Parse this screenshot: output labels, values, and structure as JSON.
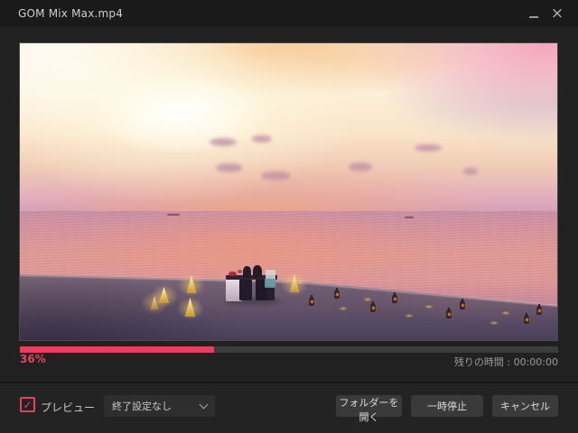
{
  "window": {
    "title": "GOM Mix Max.mp4",
    "close_glyph": "×"
  },
  "colors": {
    "accent_pink": "#ee3d5c",
    "checkbox_red": "#e04560",
    "button_bg": "#3a3a3a",
    "titlebar_bg": "#1a1a1a",
    "dialog_bg": "#212121"
  },
  "video_scene": {
    "description_colors": {
      "sky_glow": "#fdf3d8",
      "sky_pink": "#f2a0ba",
      "ocean_reflection": "#e29a93",
      "sand": "#6b5a6d",
      "lantern_glow": "#f1cd69"
    }
  },
  "progress": {
    "percent": 36,
    "percent_label": "36%",
    "remaining_label": "残りの時間 : 00:00:00"
  },
  "footer": {
    "preview": {
      "label": "プレビュー",
      "checked": true,
      "check_glyph": "✓"
    },
    "end_action": {
      "value": "終了設定なし"
    },
    "buttons": [
      {
        "label": "フォルダーを開く"
      },
      {
        "label": "一時停止"
      },
      {
        "label": "キャンセル"
      }
    ]
  }
}
